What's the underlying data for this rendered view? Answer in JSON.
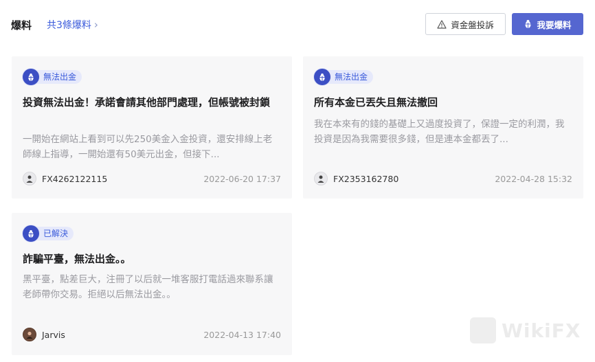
{
  "header": {
    "title": "爆料",
    "count_link": "共3條爆料",
    "risk_button": "資金盤投訴",
    "expose_button": "我要爆料"
  },
  "cards": [
    {
      "status": "無法出金",
      "title": "投資無法出金！承諾會請其他部門處理，但帳號被封鎖",
      "desc": "一開始在網站上看到可以先250美金入金投資，還安排線上老師線上指導，一開始還有50美元出金，但接下...",
      "user": "FX4262122115",
      "time": "2022-06-20 17:37"
    },
    {
      "status": "無法出金",
      "title": "所有本金已丟失且無法撤回",
      "desc": "我在本來有的錢的基礎上又過度投資了，保證一定的利潤，我投資是因為我需要很多錢，但是連本金都丟了...",
      "user": "FX2353162780",
      "time": "2022-04-28 15:32"
    },
    {
      "status": "已解決",
      "title": "詐騙平臺，無法出金。。",
      "desc": "黑平臺，點差巨大，注冊了以后就一堆客服打電話過來聯系讓老師帶你交易。拒絕以后無法出金。。",
      "user": "Jarvis",
      "time": "2022-04-13 17:40"
    }
  ],
  "colors": {
    "accent": "#3b5bdb",
    "primary_button": "#5566d0",
    "card_bg": "#f7f7f8",
    "muted_text": "#9a9aa0"
  },
  "icons": {
    "chevron": "chevron-right-icon",
    "warning": "warning-triangle-icon",
    "bug": "bug-icon",
    "avatar": "user-avatar-icon"
  },
  "watermark": "WikiFX"
}
